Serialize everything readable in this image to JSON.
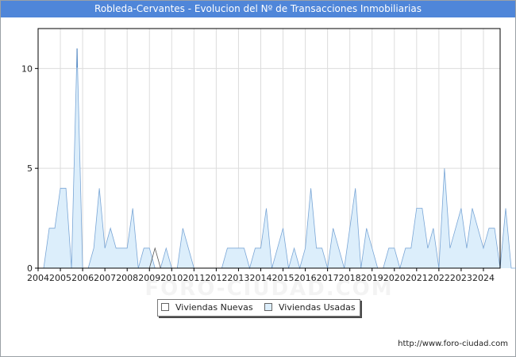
{
  "title": "Robleda-Cervantes - Evolucion del Nº de Transacciones Inmobiliarias",
  "footer_url": "http://www.foro-ciudad.com",
  "watermark": "FORO-CIUDAD.COM",
  "chart_data": {
    "type": "area",
    "title": "Robleda-Cervantes - Evolucion del Nº de Transacciones Inmobiliarias",
    "xlabel": "",
    "ylabel": "",
    "x_unit": "quarter",
    "x_start": "2004-Q1",
    "xlim": [
      2004,
      2024.75
    ],
    "ylim": [
      0,
      12
    ],
    "x_ticks": [
      "2004",
      "2005",
      "2006",
      "2007",
      "2008",
      "2009",
      "2010",
      "2011",
      "2012",
      "2013",
      "2014",
      "2015",
      "2016",
      "2017",
      "2018",
      "2019",
      "2020",
      "2021",
      "2022",
      "2023",
      "2024"
    ],
    "y_ticks": [
      0,
      5,
      10
    ],
    "grid": true,
    "legend_position": "bottom",
    "series": [
      {
        "name": "Viviendas Nuevas",
        "color": "#ffffff",
        "line_color": "#555555",
        "values": [
          0,
          0,
          0,
          0,
          0,
          0,
          0,
          0,
          0,
          0,
          0,
          0,
          0,
          0,
          0,
          0,
          0,
          0,
          0,
          0,
          0,
          1,
          0,
          0,
          0,
          0,
          0,
          0,
          0,
          0,
          0,
          0,
          0,
          0,
          0,
          0,
          0,
          0,
          0,
          0,
          0,
          0,
          0,
          0,
          0,
          0,
          0,
          0,
          0,
          0,
          0,
          0,
          0,
          0,
          0,
          0,
          0,
          0,
          0,
          0,
          0,
          0,
          0,
          0,
          0,
          0,
          0,
          0,
          0,
          0,
          0,
          0,
          0,
          0,
          0,
          0,
          0,
          0,
          0,
          0,
          0,
          0,
          0,
          0
        ]
      },
      {
        "name": "Viviendas Usadas",
        "color": "#dceefb",
        "line_color": "#7aa6d6",
        "values": [
          0,
          0,
          2,
          2,
          4,
          4,
          0,
          11,
          0,
          0,
          1,
          4,
          1,
          2,
          1,
          1,
          1,
          3,
          0,
          1,
          1,
          0,
          0,
          1,
          0,
          0,
          2,
          1,
          0,
          0,
          0,
          0,
          0,
          0,
          1,
          1,
          1,
          1,
          0,
          1,
          1,
          3,
          0,
          1,
          2,
          0,
          1,
          0,
          1,
          4,
          1,
          1,
          0,
          2,
          1,
          0,
          2,
          4,
          0,
          2,
          1,
          0,
          0,
          1,
          1,
          0,
          1,
          1,
          3,
          3,
          1,
          2,
          0,
          5,
          1,
          2,
          3,
          1,
          3,
          2,
          1,
          2,
          2,
          0,
          3,
          0,
          0,
          0
        ]
      }
    ]
  }
}
